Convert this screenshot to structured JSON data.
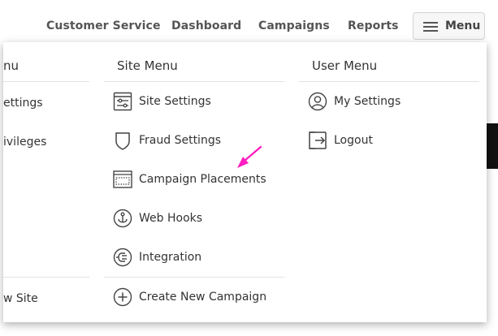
{
  "nav": {
    "links": [
      "Customer Service",
      "Dashboard",
      "Campaigns",
      "Reports"
    ],
    "menu_label": "Menu"
  },
  "left_column": {
    "heading_partial": "nu",
    "items": [
      "ettings",
      "ivileges"
    ],
    "bottom_item": "w Site"
  },
  "site_menu": {
    "heading": "Site Menu",
    "items": [
      {
        "label": "Site Settings",
        "icon": "site-settings-icon"
      },
      {
        "label": "Fraud Settings",
        "icon": "shield-icon"
      },
      {
        "label": "Campaign Placements",
        "icon": "placements-icon"
      },
      {
        "label": "Web Hooks",
        "icon": "webhooks-icon"
      },
      {
        "label": "Integration",
        "icon": "plug-icon"
      }
    ],
    "bottom_item": {
      "label": "Create New Campaign",
      "icon": "plus-circle-icon"
    }
  },
  "user_menu": {
    "heading": "User Menu",
    "items": [
      {
        "label": "My Settings",
        "icon": "user-circle-icon"
      },
      {
        "label": "Logout",
        "icon": "logout-icon"
      }
    ]
  },
  "colors": {
    "annotation_arrow": "#ff1ec0",
    "icon_stroke": "#444444",
    "text": "#333333"
  }
}
